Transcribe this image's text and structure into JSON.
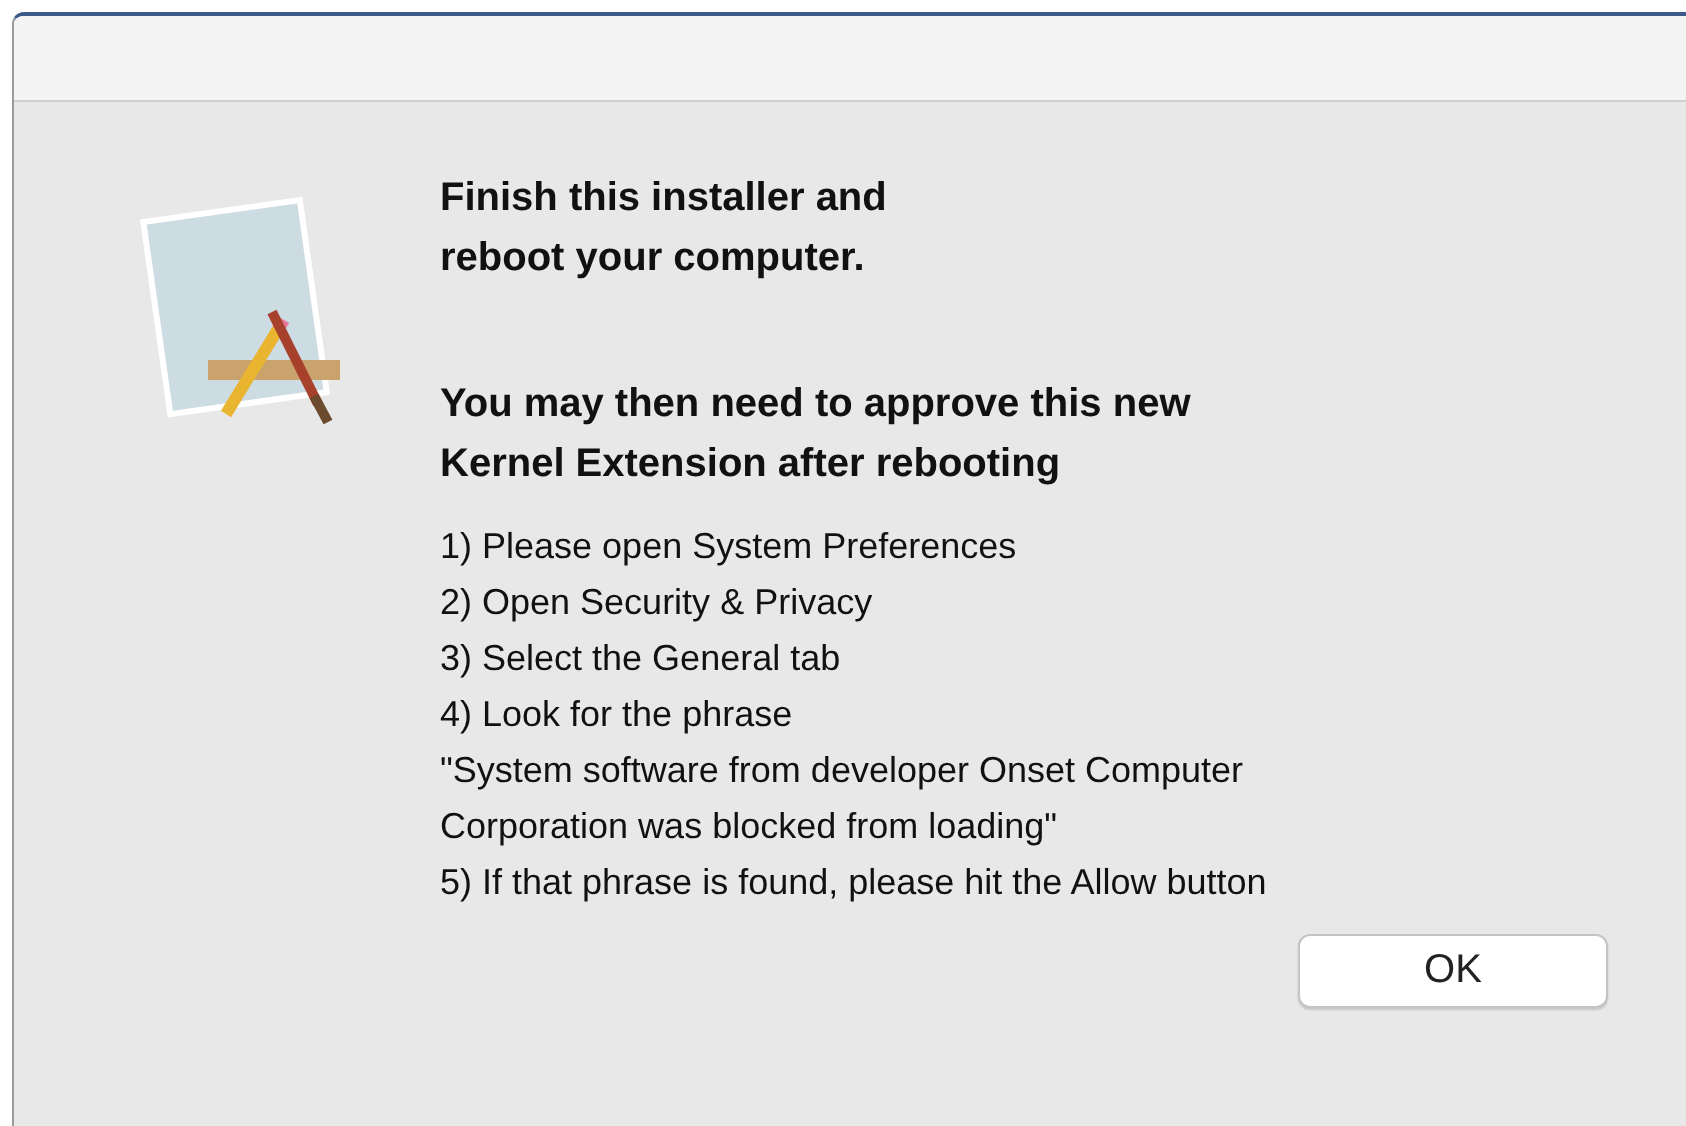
{
  "heading": "Finish this installer and\nreboot your computer.",
  "subheading": "You may then need to approve this new\nKernel Extension after rebooting",
  "steps": [
    "1) Please open System Preferences",
    "2) Open Security & Privacy",
    "3) Select the General tab",
    "4) Look for the phrase",
    "\"System software from developer Onset Computer\nCorporation was blocked from loading\"",
    "5) If that phrase is found, please hit the Allow button"
  ],
  "buttons": [
    "OK"
  ]
}
